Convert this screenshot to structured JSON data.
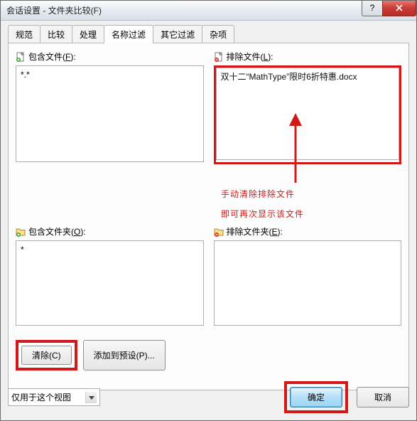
{
  "title": "会话设置 - 文件夹比较(F)",
  "window_buttons": {
    "help": "?",
    "close": "X"
  },
  "tabs": [
    {
      "label": "规范"
    },
    {
      "label": "比较"
    },
    {
      "label": "处理"
    },
    {
      "label": "名称过滤",
      "active": true
    },
    {
      "label": "其它过滤"
    },
    {
      "label": "杂项"
    }
  ],
  "panels": {
    "include_files": {
      "icon": "file-plus-icon",
      "label_pre": "包含文件(",
      "label_key": "F",
      "label_post": "):",
      "value": "*.*"
    },
    "exclude_files": {
      "icon": "file-minus-icon",
      "label_pre": "排除文件(",
      "label_key": "L",
      "label_post": "):",
      "value": "双十二“MathType”限时6折特惠.docx"
    },
    "include_folders": {
      "icon": "folder-plus-icon",
      "label_pre": "包含文件夹(",
      "label_key": "O",
      "label_post": "):",
      "value": "*"
    },
    "exclude_folders": {
      "icon": "folder-minus-icon",
      "label_pre": "排除文件夹(",
      "label_key": "E",
      "label_post": "):",
      "value": ""
    }
  },
  "buttons": {
    "clear": "清除(C)",
    "add_preset": "添加到预设(P)...",
    "ok": "确定",
    "cancel": "取消"
  },
  "scope_combo": {
    "value": "仅用于这个视图"
  },
  "annotation": {
    "line1": "手动清除排除文件",
    "line2": "即可再次显示该文件"
  },
  "colors": {
    "red": "#d31818",
    "accent": "#3c7fb1"
  }
}
